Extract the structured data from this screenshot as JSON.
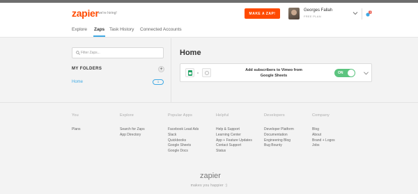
{
  "header": {
    "logo": "zapier",
    "hiring": "we're hiring!",
    "make_zap": "MAKE A ZAP!",
    "user_name": "Georges Fallah",
    "user_plan": "FREE PLAN",
    "notification_count": "1"
  },
  "tabs": [
    {
      "label": "Explore",
      "active": false
    },
    {
      "label": "Zaps",
      "active": true
    },
    {
      "label": "Task History",
      "active": false
    },
    {
      "label": "Connected Accounts",
      "active": false
    }
  ],
  "sidebar": {
    "search_placeholder": "Filter Zaps...",
    "folders_title": "MY FOLDERS",
    "add_label": "+",
    "folders": [
      {
        "label": "Home",
        "count": "1"
      }
    ]
  },
  "main": {
    "title": "Home",
    "zap": {
      "name": "Add subscribers to Vimeo from Google Sheets",
      "toggle_label": "ON",
      "apps": [
        "google-sheets-icon",
        "vimeo-icon"
      ]
    }
  },
  "footer": {
    "columns": [
      {
        "heading": "You",
        "links": [
          "Plans"
        ]
      },
      {
        "heading": "Explore",
        "links": [
          "Search for Zaps",
          "App Directory"
        ]
      },
      {
        "heading": "Popular Apps",
        "links": [
          "Facebook Lead Ads",
          "Slack",
          "Quickbooks",
          "Google Sheets",
          "Google Docs"
        ]
      },
      {
        "heading": "Helpful",
        "links": [
          "Help & Support",
          "Learning Center",
          "App + Feature Updates",
          "Contact Support",
          "Status"
        ]
      },
      {
        "heading": "Developers",
        "links": [
          "Developer Platform",
          "Documentation",
          "Engineering Blog",
          "Bug Bounty"
        ]
      },
      {
        "heading": "Company",
        "links": [
          "Blog",
          "About",
          "Brand + Logos",
          "Jobs"
        ]
      }
    ],
    "logo": "zapier",
    "tagline": "makes you happier :)"
  },
  "colors": {
    "brand": "#ff4a00",
    "accent": "#3fa9e4",
    "toggle_on": "#5cc47f"
  }
}
